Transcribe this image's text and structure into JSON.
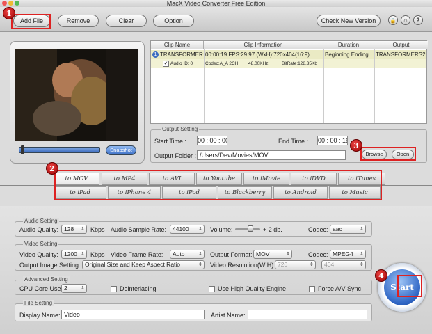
{
  "window": {
    "title": "MacX Video Converter Free Edition"
  },
  "toolbar": {
    "add_file": "Add File",
    "remove": "Remove",
    "clear": "Clear",
    "option": "Option",
    "check_version": "Check New Version",
    "icons": [
      "lock-icon",
      "home-icon",
      "help-icon"
    ],
    "icon_glyphs": {
      "lock": "🔒",
      "home": "⌂",
      "help": "?"
    }
  },
  "badges": [
    "1",
    "2",
    "3",
    "4"
  ],
  "preview": {
    "snapshot": "Snapshot",
    "progress": 0.02
  },
  "clip_table": {
    "headers": [
      "Clip Name",
      "Clip Information",
      "Duration",
      "Output"
    ],
    "row": {
      "name": "TRANSFORMERS",
      "info": "00:00:19  FPS:29.97  (WxH):720x404(16:9)",
      "duration": "Beginning Ending",
      "output": "TRANSFORMERS2."
    },
    "subrow": {
      "audio_id": "Audio ID: 0",
      "codec": "Codec:A_A 2CH",
      "freq": "48.00KHz",
      "bitrate": "BitRate:128.35Kb"
    }
  },
  "output_setting": {
    "legend": "Output Setting",
    "start_label": "Start Time :",
    "start_time": "00 : 00 : 00",
    "end_label": "End Time :",
    "end_time": "00 : 00 : 19",
    "folder_label": "Output Folder :",
    "folder": "/Users/Dev/Movies/MOV",
    "browse": "Browse",
    "open": "Open"
  },
  "format_tabs": {
    "row1": [
      "to MOV",
      "to MP4",
      "to AVI",
      "to Youtube",
      "to iMovie",
      "to iDVD",
      "to iTunes"
    ],
    "row2": [
      "to iPad",
      "to iPhone 4",
      "to iPod",
      "to Blackberry",
      "to Android",
      "to Music"
    ],
    "active": "to MOV"
  },
  "audio": {
    "legend": "Audio Setting",
    "quality_label": "Audio Quality:",
    "quality": "128",
    "kbps": "Kbps",
    "rate_label": "Audio Sample Rate:",
    "rate": "44100",
    "volume_label": "Volume:",
    "volume_value": "+ 2 db.",
    "volume_level": 0.6,
    "codec_label": "Codec:",
    "codec": "aac"
  },
  "video": {
    "legend": "Video Setting",
    "quality_label": "Video Quality:",
    "quality": "1200",
    "kbps": "Kbps",
    "fr_label": "Video Frame Rate:",
    "fr": "Auto",
    "format_label": "Output Format:",
    "format": "MOV",
    "codec_label": "Codec:",
    "codec": "MPEG4",
    "image_label": "Output Image Setting:",
    "image": "Original Size and Keep Aspect Ratio",
    "res_label": "Video Resolution(W:H):",
    "res_w": "720",
    "res_h": "404"
  },
  "advanced": {
    "legend": "Advanced Setting",
    "cpu_label": "CPU Core Use:",
    "cpu": "2",
    "deinterlacing": "Deinterlacing",
    "high_quality": "Use High Quality Engine",
    "force_sync": "Force A/V Sync"
  },
  "file": {
    "legend": "File Setting",
    "display_label": "Display Name:",
    "display": "Video",
    "artist_label": "Artist Name:",
    "artist": ""
  },
  "start_button": "Start"
}
